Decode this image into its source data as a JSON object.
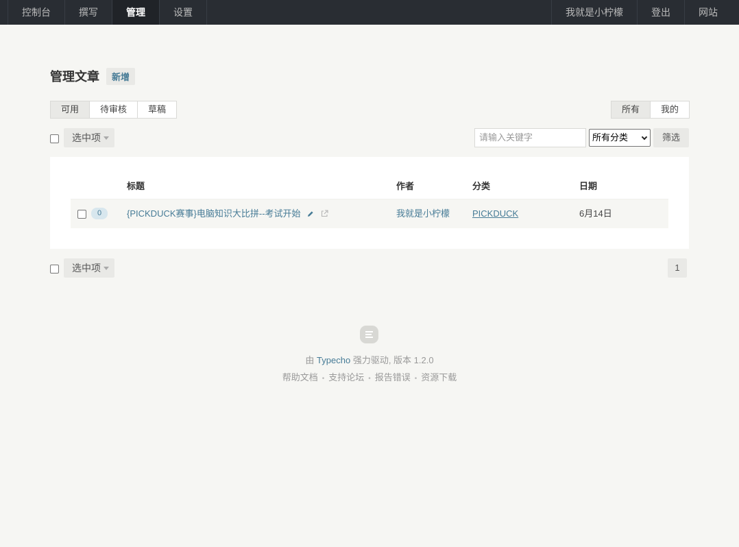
{
  "nav": {
    "left": [
      {
        "label": "控制台",
        "active": false
      },
      {
        "label": "撰写",
        "active": false
      },
      {
        "label": "管理",
        "active": true
      },
      {
        "label": "设置",
        "active": false
      }
    ],
    "right": [
      {
        "label": "我就是小柠檬"
      },
      {
        "label": "登出"
      },
      {
        "label": "网站"
      }
    ]
  },
  "header": {
    "title": "管理文章",
    "new_label": "新增"
  },
  "status_tabs": [
    "可用",
    "待审核",
    "草稿"
  ],
  "scope_tabs": [
    "所有",
    "我的"
  ],
  "toolbar": {
    "selected_label": "选中项",
    "search_placeholder": "请输入关键字",
    "category_value": "所有分类",
    "filter_label": "筛选"
  },
  "table": {
    "headers": {
      "title": "标题",
      "author": "作者",
      "category": "分类",
      "date": "日期"
    },
    "rows": [
      {
        "comments": "0",
        "title": "{PICKDUCK赛事}电脑知识大比拼--考试开始",
        "author": "我就是小柠檬",
        "category": "PICKDUCK",
        "date": "6月14日"
      }
    ]
  },
  "pagination": {
    "current": "1"
  },
  "footer": {
    "prefix": "由",
    "brand": "Typecho",
    "suffix": "强力驱动, 版本 1.2.0",
    "links": [
      "帮助文档",
      "支持论坛",
      "报告错误",
      "资源下载"
    ]
  },
  "colors": {
    "nav_bg": "#292d33",
    "accent": "#467b96",
    "page_bg": "#f6f6f3"
  }
}
